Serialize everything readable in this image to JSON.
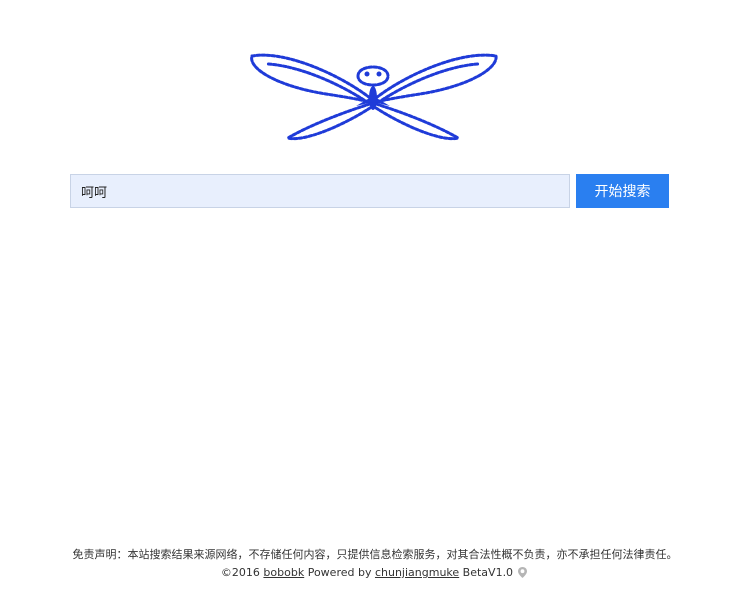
{
  "logo": {
    "icon": "butterfly-logo-icon",
    "color": "#1f3bd8"
  },
  "search": {
    "value": "呵呵",
    "button_label": "开始搜索",
    "button_color": "#2a7ff0"
  },
  "footer": {
    "disclaimer": "免责声明：本站搜索结果来源网络，不存储任何内容，只提供信息检索服务，对其合法性概不负责，亦不承担任何法律责任。",
    "copyright_prefix": "©2016",
    "site_link": "bobobk",
    "powered_by": "Powered by",
    "author_link": "chunjiangmuke",
    "version": "BetaV1.0",
    "version_icon": "location-pin-icon"
  }
}
